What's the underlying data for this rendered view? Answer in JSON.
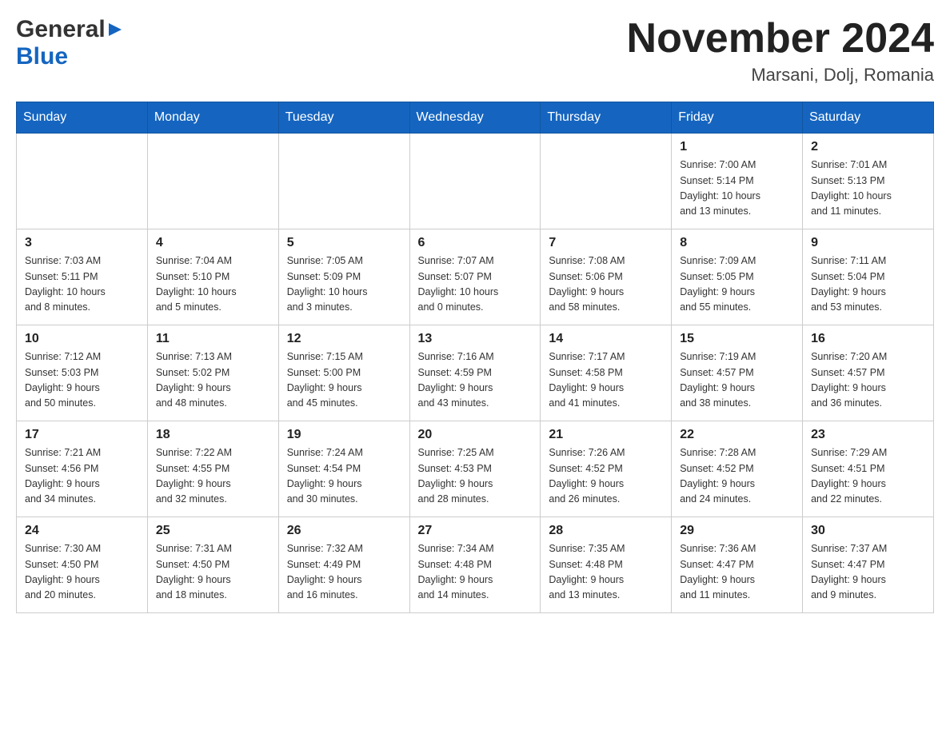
{
  "header": {
    "logo_general": "General",
    "logo_blue": "Blue",
    "title": "November 2024",
    "subtitle": "Marsani, Dolj, Romania"
  },
  "days_of_week": [
    "Sunday",
    "Monday",
    "Tuesday",
    "Wednesday",
    "Thursday",
    "Friday",
    "Saturday"
  ],
  "weeks": [
    {
      "days": [
        {
          "number": "",
          "info": ""
        },
        {
          "number": "",
          "info": ""
        },
        {
          "number": "",
          "info": ""
        },
        {
          "number": "",
          "info": ""
        },
        {
          "number": "",
          "info": ""
        },
        {
          "number": "1",
          "info": "Sunrise: 7:00 AM\nSunset: 5:14 PM\nDaylight: 10 hours\nand 13 minutes."
        },
        {
          "number": "2",
          "info": "Sunrise: 7:01 AM\nSunset: 5:13 PM\nDaylight: 10 hours\nand 11 minutes."
        }
      ]
    },
    {
      "days": [
        {
          "number": "3",
          "info": "Sunrise: 7:03 AM\nSunset: 5:11 PM\nDaylight: 10 hours\nand 8 minutes."
        },
        {
          "number": "4",
          "info": "Sunrise: 7:04 AM\nSunset: 5:10 PM\nDaylight: 10 hours\nand 5 minutes."
        },
        {
          "number": "5",
          "info": "Sunrise: 7:05 AM\nSunset: 5:09 PM\nDaylight: 10 hours\nand 3 minutes."
        },
        {
          "number": "6",
          "info": "Sunrise: 7:07 AM\nSunset: 5:07 PM\nDaylight: 10 hours\nand 0 minutes."
        },
        {
          "number": "7",
          "info": "Sunrise: 7:08 AM\nSunset: 5:06 PM\nDaylight: 9 hours\nand 58 minutes."
        },
        {
          "number": "8",
          "info": "Sunrise: 7:09 AM\nSunset: 5:05 PM\nDaylight: 9 hours\nand 55 minutes."
        },
        {
          "number": "9",
          "info": "Sunrise: 7:11 AM\nSunset: 5:04 PM\nDaylight: 9 hours\nand 53 minutes."
        }
      ]
    },
    {
      "days": [
        {
          "number": "10",
          "info": "Sunrise: 7:12 AM\nSunset: 5:03 PM\nDaylight: 9 hours\nand 50 minutes."
        },
        {
          "number": "11",
          "info": "Sunrise: 7:13 AM\nSunset: 5:02 PM\nDaylight: 9 hours\nand 48 minutes."
        },
        {
          "number": "12",
          "info": "Sunrise: 7:15 AM\nSunset: 5:00 PM\nDaylight: 9 hours\nand 45 minutes."
        },
        {
          "number": "13",
          "info": "Sunrise: 7:16 AM\nSunset: 4:59 PM\nDaylight: 9 hours\nand 43 minutes."
        },
        {
          "number": "14",
          "info": "Sunrise: 7:17 AM\nSunset: 4:58 PM\nDaylight: 9 hours\nand 41 minutes."
        },
        {
          "number": "15",
          "info": "Sunrise: 7:19 AM\nSunset: 4:57 PM\nDaylight: 9 hours\nand 38 minutes."
        },
        {
          "number": "16",
          "info": "Sunrise: 7:20 AM\nSunset: 4:57 PM\nDaylight: 9 hours\nand 36 minutes."
        }
      ]
    },
    {
      "days": [
        {
          "number": "17",
          "info": "Sunrise: 7:21 AM\nSunset: 4:56 PM\nDaylight: 9 hours\nand 34 minutes."
        },
        {
          "number": "18",
          "info": "Sunrise: 7:22 AM\nSunset: 4:55 PM\nDaylight: 9 hours\nand 32 minutes."
        },
        {
          "number": "19",
          "info": "Sunrise: 7:24 AM\nSunset: 4:54 PM\nDaylight: 9 hours\nand 30 minutes."
        },
        {
          "number": "20",
          "info": "Sunrise: 7:25 AM\nSunset: 4:53 PM\nDaylight: 9 hours\nand 28 minutes."
        },
        {
          "number": "21",
          "info": "Sunrise: 7:26 AM\nSunset: 4:52 PM\nDaylight: 9 hours\nand 26 minutes."
        },
        {
          "number": "22",
          "info": "Sunrise: 7:28 AM\nSunset: 4:52 PM\nDaylight: 9 hours\nand 24 minutes."
        },
        {
          "number": "23",
          "info": "Sunrise: 7:29 AM\nSunset: 4:51 PM\nDaylight: 9 hours\nand 22 minutes."
        }
      ]
    },
    {
      "days": [
        {
          "number": "24",
          "info": "Sunrise: 7:30 AM\nSunset: 4:50 PM\nDaylight: 9 hours\nand 20 minutes."
        },
        {
          "number": "25",
          "info": "Sunrise: 7:31 AM\nSunset: 4:50 PM\nDaylight: 9 hours\nand 18 minutes."
        },
        {
          "number": "26",
          "info": "Sunrise: 7:32 AM\nSunset: 4:49 PM\nDaylight: 9 hours\nand 16 minutes."
        },
        {
          "number": "27",
          "info": "Sunrise: 7:34 AM\nSunset: 4:48 PM\nDaylight: 9 hours\nand 14 minutes."
        },
        {
          "number": "28",
          "info": "Sunrise: 7:35 AM\nSunset: 4:48 PM\nDaylight: 9 hours\nand 13 minutes."
        },
        {
          "number": "29",
          "info": "Sunrise: 7:36 AM\nSunset: 4:47 PM\nDaylight: 9 hours\nand 11 minutes."
        },
        {
          "number": "30",
          "info": "Sunrise: 7:37 AM\nSunset: 4:47 PM\nDaylight: 9 hours\nand 9 minutes."
        }
      ]
    }
  ]
}
